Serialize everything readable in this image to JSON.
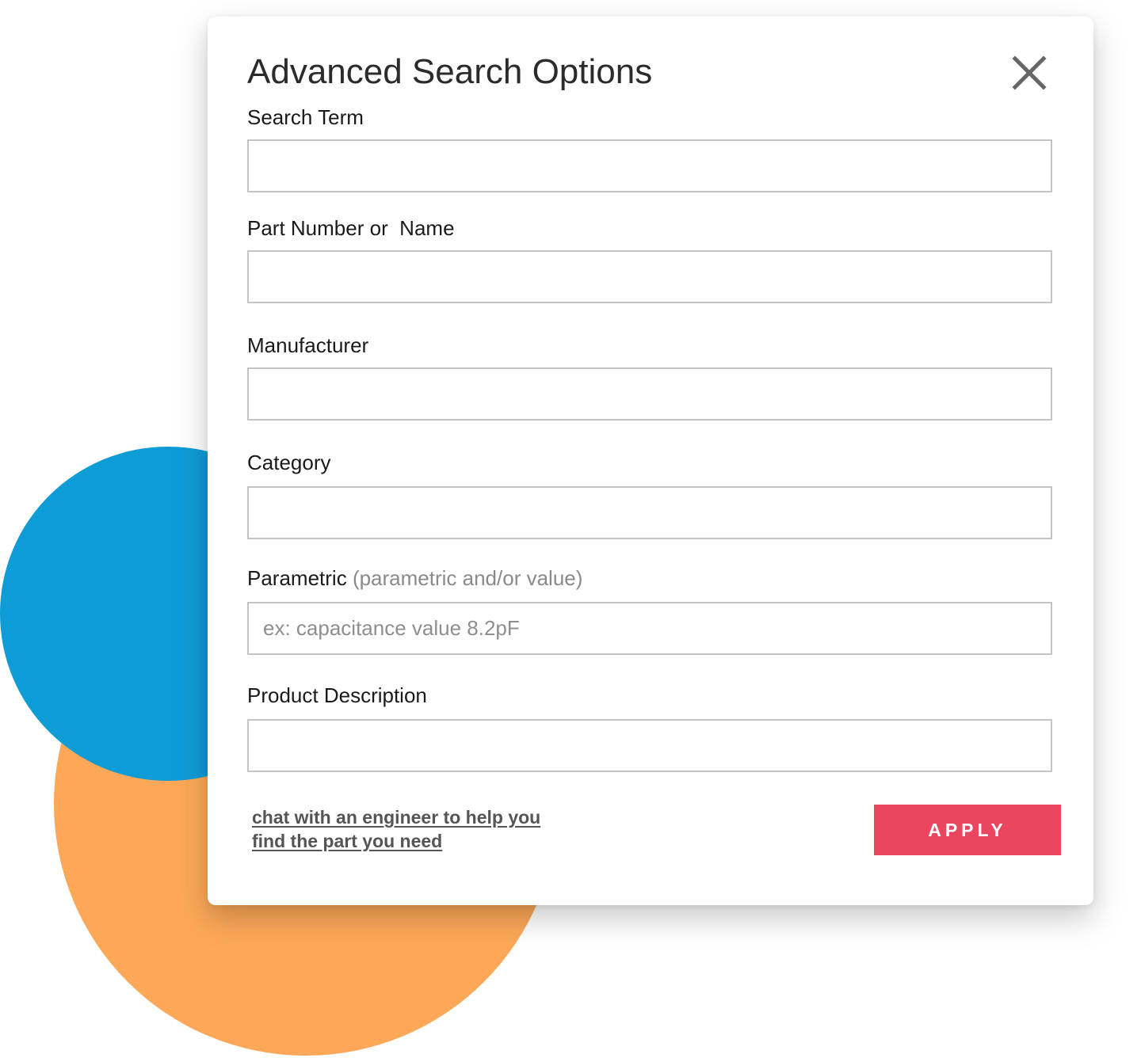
{
  "dialog": {
    "title": "Advanced Search Options",
    "close_icon": "close-icon"
  },
  "fields": [
    {
      "label": "Search Term",
      "value": "",
      "placeholder": ""
    },
    {
      "label": "Part Number or  Name",
      "value": "",
      "placeholder": ""
    },
    {
      "label": "Manufacturer",
      "value": "",
      "placeholder": ""
    },
    {
      "label": "Category",
      "value": "",
      "placeholder": ""
    },
    {
      "label": "Parametric",
      "hint": "(parametric and/or value)",
      "value": "",
      "placeholder": "ex: capacitance value 8.2pF"
    },
    {
      "label": "Product Description",
      "value": "",
      "placeholder": ""
    }
  ],
  "help_link": {
    "line1": "chat with an engineer to help you",
    "line2": "find the part you need"
  },
  "apply_button": {
    "label": "APPLY"
  },
  "colors": {
    "apply_button": "#ea4660",
    "accent_blue": "#0e9cd7",
    "accent_orange": "#fda858"
  }
}
